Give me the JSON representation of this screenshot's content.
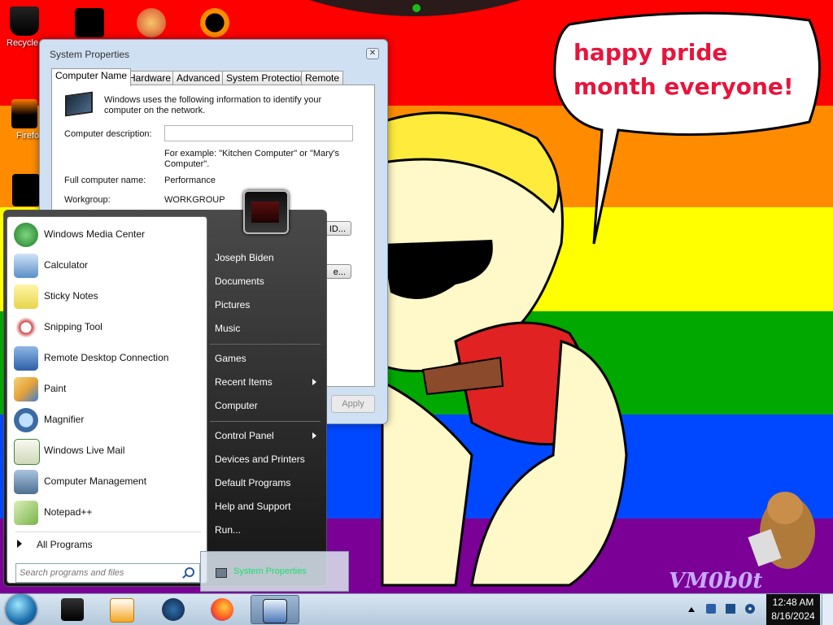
{
  "wallpaper": {
    "bubble_text": "happy pride month everyone!",
    "watermark": "VM0b0t",
    "colors": {
      "red": "#ff0000",
      "orange": "#ff8c00",
      "yellow": "#ffff00",
      "green": "#00a800",
      "blue": "#0048ff",
      "purple": "#7a0096"
    }
  },
  "desktop_icons": [
    {
      "label": "Recycle",
      "icon": "recycle-bin-icon"
    },
    {
      "label": "Firefo",
      "icon": "firefox-icon"
    },
    {
      "label": "",
      "icon": "program-icon"
    },
    {
      "label": "",
      "icon": "program-icon"
    },
    {
      "label": "",
      "icon": "program-icon"
    },
    {
      "label": "",
      "icon": "program-icon"
    }
  ],
  "system_properties": {
    "title": "System Properties",
    "tabs": [
      "Computer Name",
      "Hardware",
      "Advanced",
      "System Protection",
      "Remote"
    ],
    "active_tab": "Computer Name",
    "intro": "Windows uses the following information to identify your computer on the network.",
    "computer_description_label": "Computer description:",
    "computer_description_value": "",
    "example_text": "For example: \"Kitchen Computer\" or \"Mary's Computer\".",
    "full_name_label": "Full computer name:",
    "full_name_value": "Performance",
    "workgroup_label": "Workgroup:",
    "workgroup_value": "WORKGROUP",
    "network_id_button": "ID...",
    "change_button": "e...",
    "apply_button": "Apply"
  },
  "start_menu": {
    "programs": [
      {
        "label": "Windows Media Center",
        "icon": "windows-media-center-icon",
        "color": "#2f9a3a"
      },
      {
        "label": "Calculator",
        "icon": "calculator-icon",
        "color": "#5b8fc7"
      },
      {
        "label": "Sticky Notes",
        "icon": "sticky-notes-icon",
        "color": "#f2e36b"
      },
      {
        "label": "Snipping Tool",
        "icon": "snipping-tool-icon",
        "color": "#d04040"
      },
      {
        "label": "Remote Desktop Connection",
        "icon": "remote-desktop-icon",
        "color": "#2d5fa8"
      },
      {
        "label": "Paint",
        "icon": "paint-icon",
        "color": "#e6a23a"
      },
      {
        "label": "Magnifier",
        "icon": "magnifier-icon",
        "color": "#3c6aa3"
      },
      {
        "label": "Windows Live Mail",
        "icon": "windows-live-mail-icon",
        "color": "#3d8a3d"
      },
      {
        "label": "Computer Management",
        "icon": "computer-management-icon",
        "color": "#4f6f8f"
      },
      {
        "label": "Notepad++",
        "icon": "notepad-plus-plus-icon",
        "color": "#7bb24a"
      }
    ],
    "all_programs": "All Programs",
    "search_placeholder": "Search programs and files",
    "right_links": [
      {
        "label": "Joseph Biden",
        "submenu": false
      },
      {
        "label": "Documents",
        "submenu": false
      },
      {
        "label": "Pictures",
        "submenu": false
      },
      {
        "label": "Music",
        "submenu": false
      },
      {
        "label": "Games",
        "submenu": false
      },
      {
        "label": "Recent Items",
        "submenu": true
      },
      {
        "label": "Computer",
        "submenu": false
      },
      {
        "label": "Control Panel",
        "submenu": true
      },
      {
        "label": "Devices and Printers",
        "submenu": false
      },
      {
        "label": "Default Programs",
        "submenu": false
      },
      {
        "label": "Help and Support",
        "submenu": false
      },
      {
        "label": "Run...",
        "submenu": false
      }
    ]
  },
  "taskbar_preview": {
    "label": "System Properties"
  },
  "taskbar": {
    "buttons": [
      {
        "icon": "program-icon",
        "active": false
      },
      {
        "icon": "media-player-icon",
        "active": false
      },
      {
        "icon": "globe-icon",
        "active": false
      },
      {
        "icon": "firefox-icon",
        "active": false
      },
      {
        "icon": "system-properties-icon",
        "active": true
      }
    ],
    "clock_time": "12:48 AM",
    "clock_date": "8/16/2024"
  }
}
